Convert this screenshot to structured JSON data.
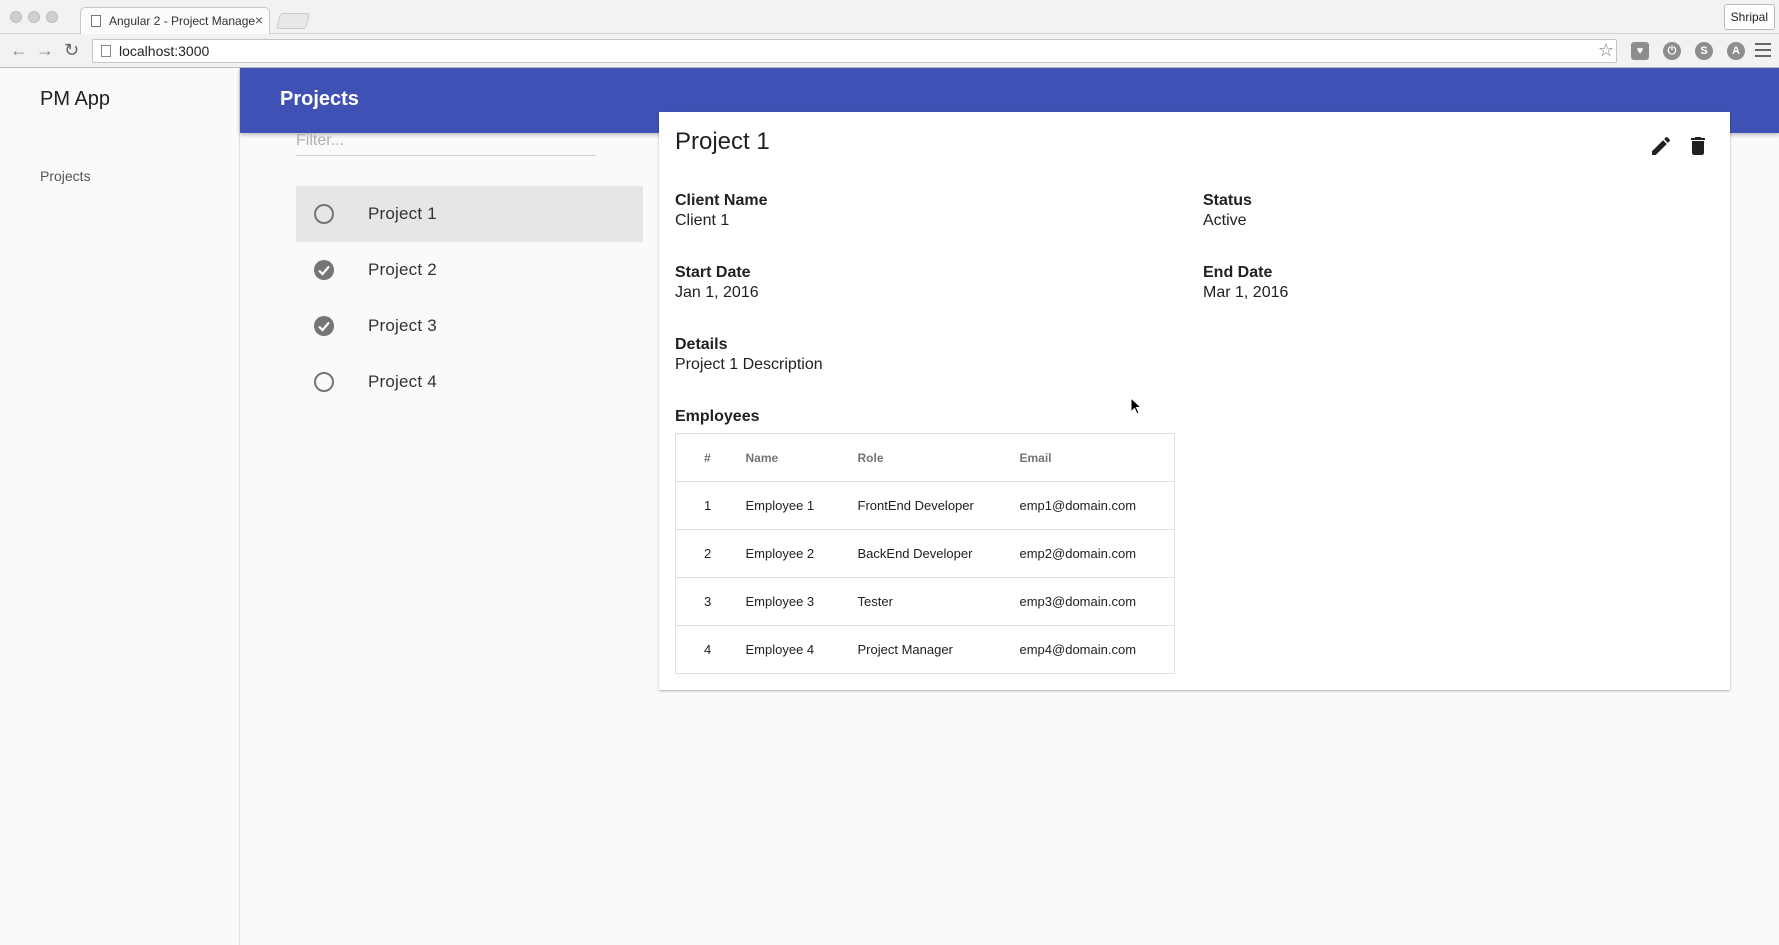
{
  "browser": {
    "tab_title": "Angular 2 - Project Manage",
    "url": "localhost:3000",
    "profile_name": "Shripal"
  },
  "app": {
    "brand": "PM App",
    "sidebar": {
      "items": [
        {
          "label": "Projects"
        }
      ]
    },
    "header": {
      "title": "Projects"
    },
    "filter": {
      "placeholder": "Filter..."
    },
    "projects": [
      {
        "label": "Project 1",
        "status_icon": "radio-unchecked-icon"
      },
      {
        "label": "Project 2",
        "status_icon": "check-circle-icon"
      },
      {
        "label": "Project 3",
        "status_icon": "check-circle-icon"
      },
      {
        "label": "Project 4",
        "status_icon": "radio-unchecked-icon"
      }
    ],
    "detail": {
      "title": "Project 1",
      "client_name_label": "Client Name",
      "client_name": "Client 1",
      "status_label": "Status",
      "status": "Active",
      "start_date_label": "Start Date",
      "start_date": "Jan 1, 2016",
      "end_date_label": "End Date",
      "end_date": "Mar 1, 2016",
      "details_label": "Details",
      "details": "Project 1 Description",
      "employees_label": "Employees",
      "employee_columns": [
        "#",
        "Name",
        "Role",
        "Email"
      ],
      "employees": [
        {
          "num": "1",
          "name": "Employee 1",
          "role": "FrontEnd Developer",
          "email": "emp1@domain.com"
        },
        {
          "num": "2",
          "name": "Employee 2",
          "role": "BackEnd Developer",
          "email": "emp2@domain.com"
        },
        {
          "num": "3",
          "name": "Employee 3",
          "role": "Tester",
          "email": "emp3@domain.com"
        },
        {
          "num": "4",
          "name": "Employee 4",
          "role": "Project Manager",
          "email": "emp4@domain.com"
        }
      ]
    }
  },
  "colors": {
    "header": "#3f51b5",
    "selected_row": "#e6e6e6"
  }
}
